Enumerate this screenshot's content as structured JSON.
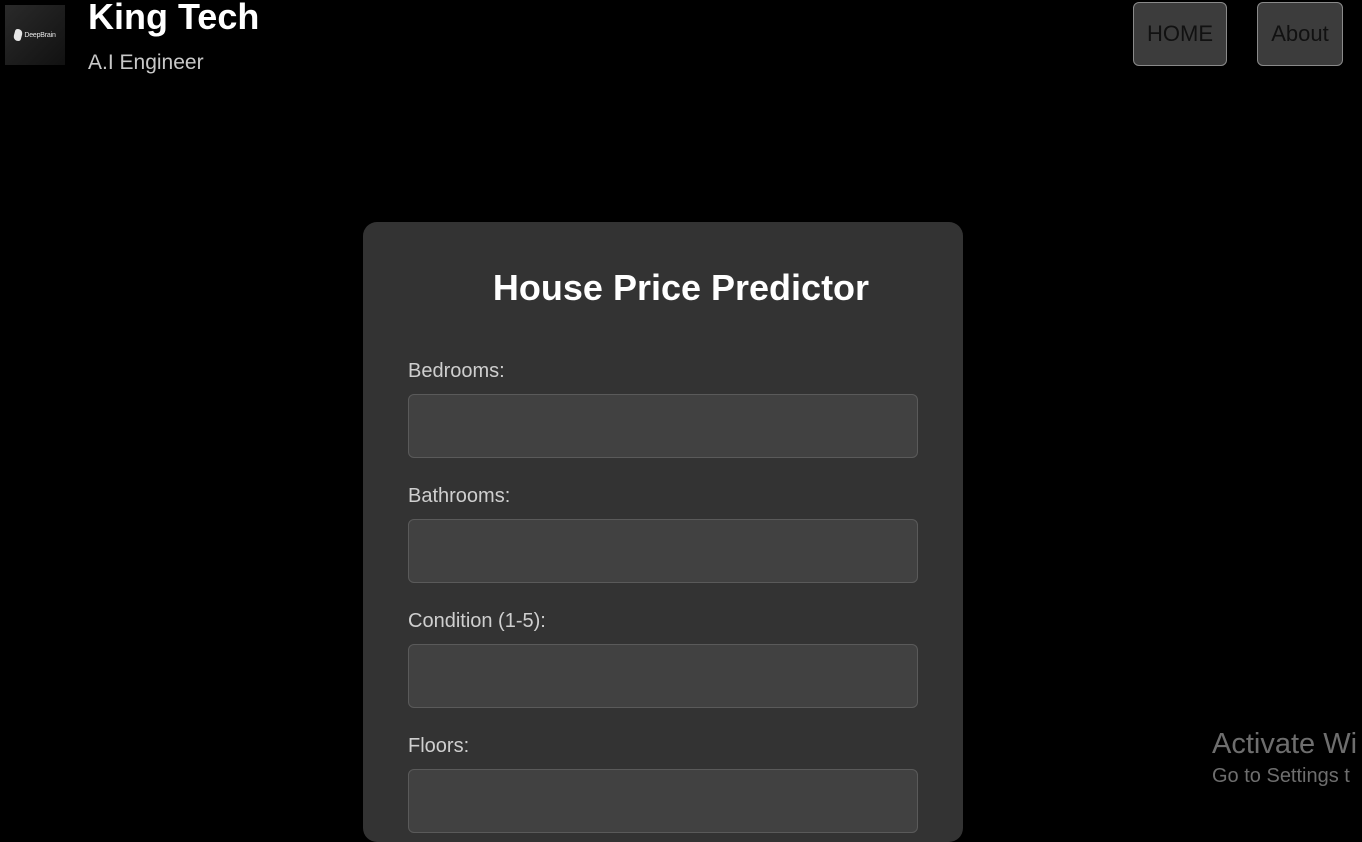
{
  "header": {
    "logo_text": "DeepBrain",
    "title": "King Tech",
    "subtitle": "A.I Engineer",
    "nav": {
      "home_label": "HOME",
      "about_label": "About"
    }
  },
  "form": {
    "title": "House Price Predictor",
    "fields": [
      {
        "label": "Bedrooms:",
        "value": "",
        "placeholder": ""
      },
      {
        "label": "Bathrooms:",
        "value": "",
        "placeholder": ""
      },
      {
        "label": "Condition (1-5):",
        "value": "",
        "placeholder": ""
      },
      {
        "label": "Floors:",
        "value": "",
        "placeholder": ""
      }
    ]
  },
  "watermark": {
    "line1": "Activate Wi",
    "line2": "Go to Settings t"
  }
}
